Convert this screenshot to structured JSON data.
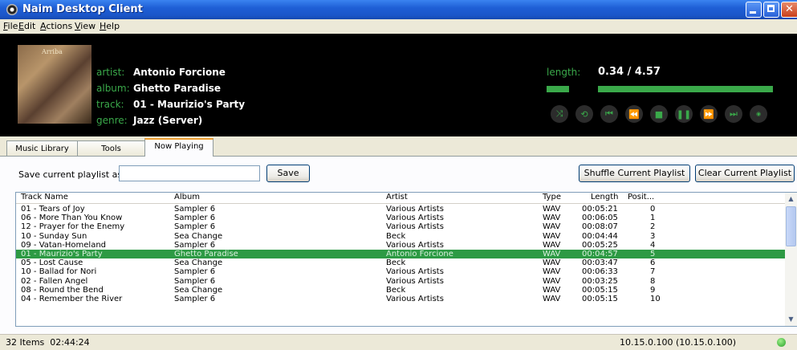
{
  "window": {
    "title": "Naim Desktop Client"
  },
  "menu": [
    "File",
    "Edit",
    "Actions",
    "View",
    "Help"
  ],
  "now_playing": {
    "cover_text": "Arriba",
    "labels": {
      "artist": "artist:",
      "album": "album:",
      "track": "track:",
      "genre": "genre:",
      "length": "length:"
    },
    "artist": "Antonio Forcione",
    "album": "Ghetto Paradise",
    "track": "01 - Maurizio's Party",
    "genre": "Jazz (Server)",
    "length": "0.34 / 4.57",
    "progress_fraction": 0.118,
    "controls": [
      "shuffle-icon",
      "repeat-icon",
      "skip-start-icon",
      "rewind-icon",
      "stop-icon",
      "pause-icon",
      "fast-forward-icon",
      "skip-end-icon",
      "radio-icon"
    ],
    "accent_color": "#3aa94a"
  },
  "tabs": [
    {
      "label": "Music Library",
      "active": false
    },
    {
      "label": "Tools",
      "active": false
    },
    {
      "label": "Now Playing",
      "active": true
    }
  ],
  "playlist_controls": {
    "save_label": "Save current playlist as:",
    "save_input_value": "",
    "save_button": "Save",
    "shuffle_button": "Shuffle Current Playlist",
    "clear_button": "Clear Current Playlist"
  },
  "table": {
    "columns": [
      "Track Name",
      "Album",
      "Artist",
      "Type",
      "Length",
      "Posit..."
    ],
    "rows": [
      {
        "track": "01 - Tears of Joy",
        "album": "Sampler 6",
        "artist": "Various Artists",
        "type": "WAV",
        "length": "00:05:21",
        "pos": "0"
      },
      {
        "track": "06 - More Than You Know",
        "album": "Sampler 6",
        "artist": "Various Artists",
        "type": "WAV",
        "length": "00:06:05",
        "pos": "1"
      },
      {
        "track": "12 - Prayer for the Enemy",
        "album": "Sampler 6",
        "artist": "Various Artists",
        "type": "WAV",
        "length": "00:08:07",
        "pos": "2"
      },
      {
        "track": "10 - Sunday Sun",
        "album": "Sea Change",
        "artist": "Beck",
        "type": "WAV",
        "length": "00:04:44",
        "pos": "3"
      },
      {
        "track": "09 - Vatan-Homeland",
        "album": "Sampler 6",
        "artist": "Various Artists",
        "type": "WAV",
        "length": "00:05:25",
        "pos": "4"
      },
      {
        "track": "01 - Maurizio's Party",
        "album": "Ghetto Paradise",
        "artist": "Antonio Forcione",
        "type": "WAV",
        "length": "00:04:57",
        "pos": "5"
      },
      {
        "track": "05 - Lost Cause",
        "album": "Sea Change",
        "artist": "Beck",
        "type": "WAV",
        "length": "00:03:47",
        "pos": "6"
      },
      {
        "track": "10 - Ballad for Nori",
        "album": "Sampler 6",
        "artist": "Various Artists",
        "type": "WAV",
        "length": "00:06:33",
        "pos": "7"
      },
      {
        "track": "02 - Fallen Angel",
        "album": "Sampler 6",
        "artist": "Various Artists",
        "type": "WAV",
        "length": "00:03:25",
        "pos": "8"
      },
      {
        "track": "08 - Round the Bend",
        "album": "Sea Change",
        "artist": "Beck",
        "type": "WAV",
        "length": "00:05:15",
        "pos": "9"
      },
      {
        "track": "04 - Remember the River",
        "album": "Sampler 6",
        "artist": "Various Artists",
        "type": "WAV",
        "length": "00:05:15",
        "pos": "10"
      }
    ],
    "selected_index": 5
  },
  "status": {
    "items": "32 Items",
    "duration": "02:44:24",
    "ip": "10.15.0.100 (10.15.0.100)",
    "connection_color": "#28a028"
  }
}
